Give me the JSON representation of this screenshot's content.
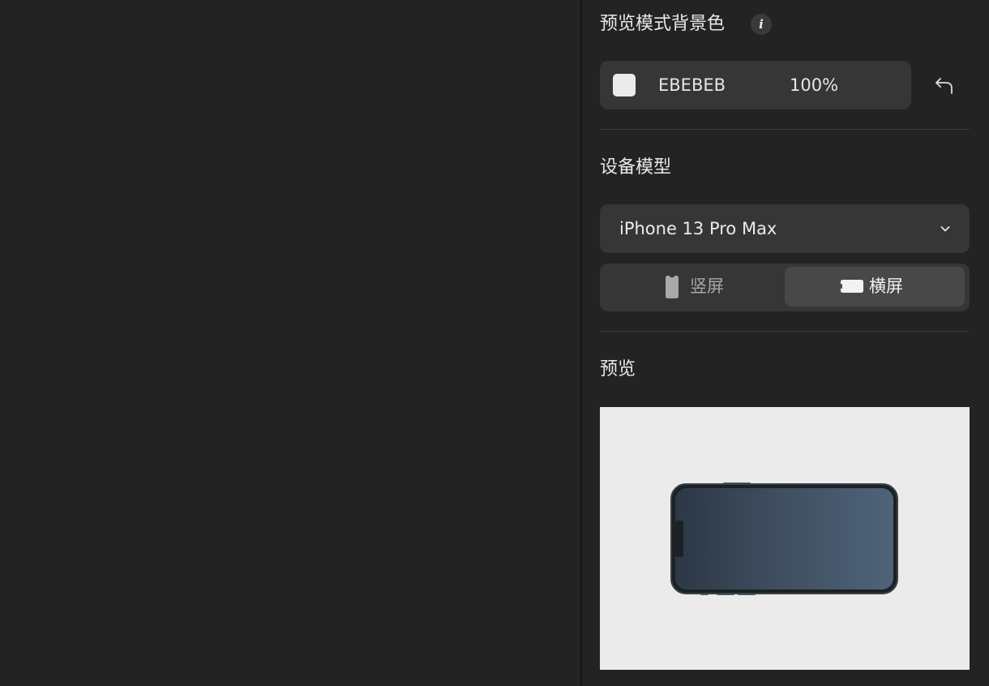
{
  "background_section": {
    "title": "预览模式背景色",
    "info_icon": "info-icon",
    "color": {
      "hex_label": "EBEBEB",
      "swatch_color": "#EBEBEB",
      "opacity_label": "100%"
    },
    "reset_icon": "undo-arrow-icon"
  },
  "device_section": {
    "title": "设备模型",
    "selected_device": "iPhone 13 Pro Max",
    "orientation": {
      "options": [
        {
          "label": "竖屏",
          "icon": "portrait-phone-icon",
          "selected": false
        },
        {
          "label": "横屏",
          "icon": "landscape-phone-icon",
          "selected": true
        }
      ]
    }
  },
  "preview_section": {
    "title": "预览",
    "background_color": "#EBEBEB"
  }
}
